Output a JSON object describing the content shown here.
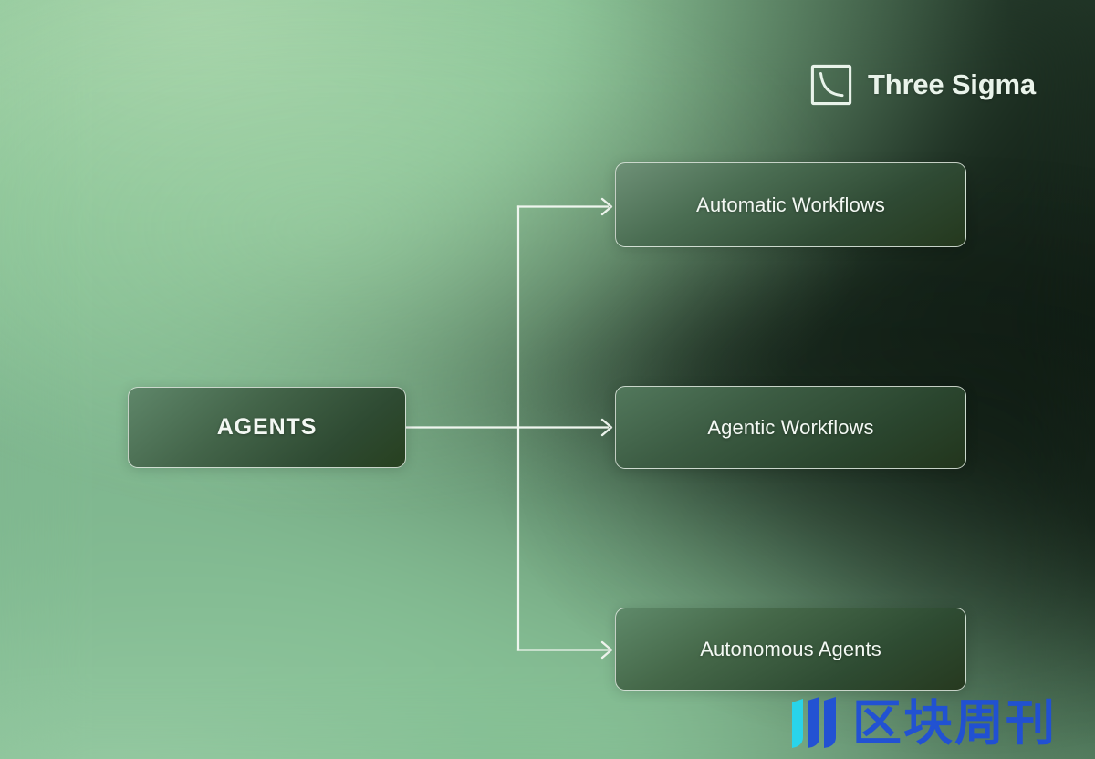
{
  "brand": {
    "name": "Three Sigma",
    "mark_icon": "three-sigma-decay-curve-logo"
  },
  "diagram": {
    "type": "flow",
    "root": {
      "id": "agents",
      "label": "AGENTS"
    },
    "branches": [
      {
        "id": "automatic",
        "label": "Automatic Workflows"
      },
      {
        "id": "agentic",
        "label": "Agentic Workflows"
      },
      {
        "id": "autonomous",
        "label": "Autonomous Agents"
      }
    ],
    "connector_icon": "arrow-right-chevron"
  },
  "watermark": {
    "text": "区块周刊",
    "mark_icon": "blockchain-weekly-bars-logo",
    "colors": {
      "primary": "#1f4fd8",
      "accent": "#25d6f0"
    }
  },
  "palette": {
    "background_light": "#9ccda4",
    "background_dark": "#16241a",
    "node_stroke": "#ecf4ec",
    "node_text": "#f3f8f3",
    "connector": "#eef5ee"
  }
}
